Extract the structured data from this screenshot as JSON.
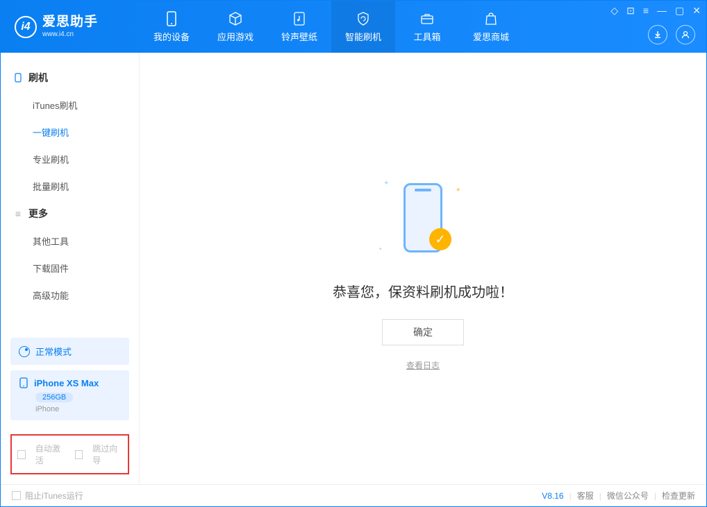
{
  "app": {
    "name": "爱思助手",
    "url": "www.i4.cn"
  },
  "nav": {
    "items": [
      {
        "label": "我的设备"
      },
      {
        "label": "应用游戏"
      },
      {
        "label": "铃声壁纸"
      },
      {
        "label": "智能刷机"
      },
      {
        "label": "工具箱"
      },
      {
        "label": "爱思商城"
      }
    ],
    "active_index": 3
  },
  "sidebar": {
    "group1": {
      "title": "刷机",
      "items": [
        "iTunes刷机",
        "一键刷机",
        "专业刷机",
        "批量刷机"
      ],
      "active_index": 1
    },
    "group2": {
      "title": "更多",
      "items": [
        "其他工具",
        "下载固件",
        "高级功能"
      ]
    }
  },
  "mode": {
    "label": "正常模式"
  },
  "device": {
    "name": "iPhone XS Max",
    "capacity": "256GB",
    "type": "iPhone"
  },
  "checkboxes": {
    "auto_activate": "自动激活",
    "skip_guide": "跳过向导"
  },
  "main": {
    "success": "恭喜您，保资料刷机成功啦！",
    "ok": "确定",
    "view_log": "查看日志"
  },
  "footer": {
    "block_itunes": "阻止iTunes运行",
    "version": "V8.16",
    "service": "客服",
    "wechat": "微信公众号",
    "update": "检查更新"
  }
}
